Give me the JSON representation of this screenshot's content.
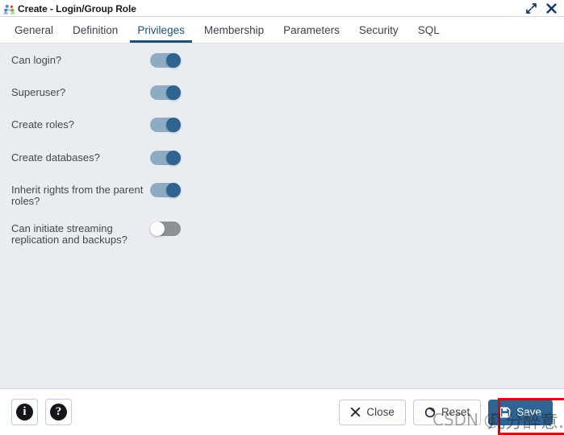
{
  "window": {
    "title": "Create - Login/Group Role",
    "icon": "group-role-icon",
    "controls": [
      {
        "name": "expand-icon",
        "label": "Expand"
      },
      {
        "name": "close-icon",
        "label": "Close"
      }
    ]
  },
  "tabs": [
    {
      "label": "General",
      "active": false
    },
    {
      "label": "Definition",
      "active": false
    },
    {
      "label": "Privileges",
      "active": true
    },
    {
      "label": "Membership",
      "active": false
    },
    {
      "label": "Parameters",
      "active": false
    },
    {
      "label": "Security",
      "active": false
    },
    {
      "label": "SQL",
      "active": false
    }
  ],
  "privileges": [
    {
      "label": "Can login?",
      "state": "on"
    },
    {
      "label": "Superuser?",
      "state": "on"
    },
    {
      "label": "Create roles?",
      "state": "on"
    },
    {
      "label": "Create databases?",
      "state": "on"
    },
    {
      "label": "Inherit rights from the parent roles?",
      "state": "on"
    },
    {
      "label": "Can initiate streaming replication and backups?",
      "state": "off"
    }
  ],
  "footer": {
    "info_label": "i",
    "help_label": "?",
    "close_label": "Close",
    "reset_label": "Reset",
    "save_label": "Save"
  },
  "annotation": {
    "highlight_color": "#e60012",
    "watermark_brand": "CSDN @",
    "watermark_handle": "几分醉意."
  },
  "colors": {
    "accent": "#2f6490",
    "toggle_on_track": "#8fabc4",
    "toggle_off_track": "#8d9196",
    "content_bg": "#e9edf2",
    "highlight": "#e60012"
  }
}
